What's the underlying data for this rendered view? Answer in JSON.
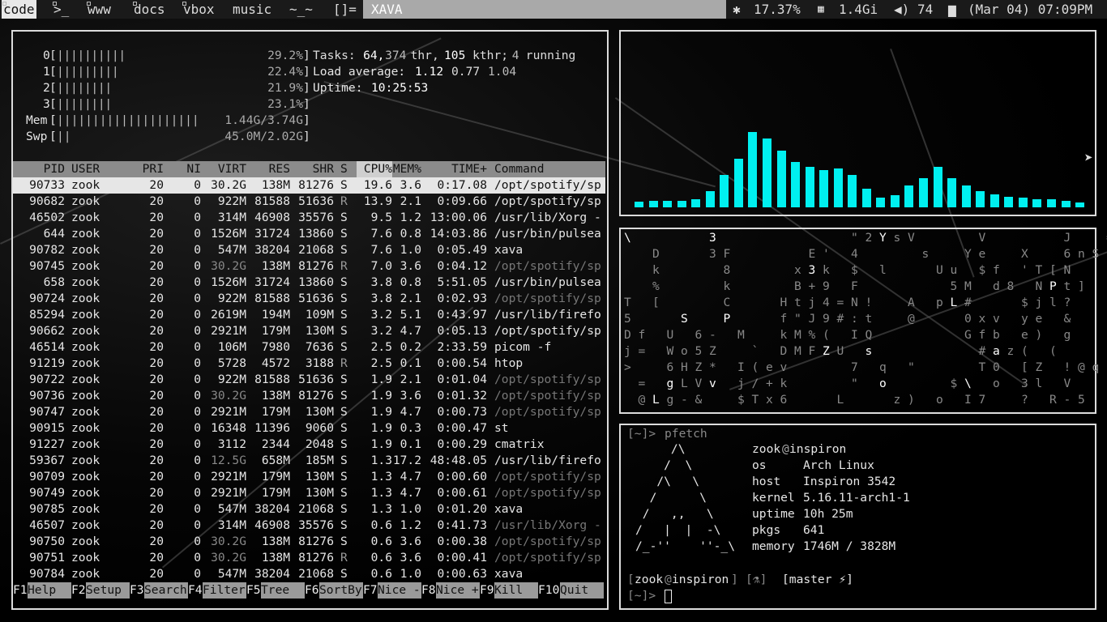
{
  "topbar": {
    "workspaces": [
      "code",
      ">_",
      "www",
      "docs",
      "vbox",
      "music",
      "~_~",
      "[]="
    ],
    "window_title": "XAVA",
    "cpu": "17.37%",
    "memory": "1.4Gi",
    "volume": "74",
    "datetime": "(Mar 04) 07:09PM",
    "icons": [
      "cpu-chip-icon",
      "memory-icon",
      "volume-icon",
      "calendar-icon"
    ]
  },
  "htop": {
    "cpus": [
      {
        "id": "0",
        "bars": "||||||||||",
        "pct": "29.2%"
      },
      {
        "id": "1",
        "bars": "|||||||||",
        "pct": "22.4%"
      },
      {
        "id": "2",
        "bars": "||||||||",
        "pct": "21.9%"
      },
      {
        "id": "3",
        "bars": "||||||||",
        "pct": "23.1%"
      }
    ],
    "mem": {
      "label": "Mem",
      "bars": "||||||||||||||||||||",
      "value": "1.44G/3.74G"
    },
    "swp": {
      "label": "Swp",
      "bars": "||",
      "value": "45.0M/2.02G"
    },
    "tasks_label": "Tasks:",
    "tasks": "64,",
    "thr": "374",
    "thr_label": "thr,",
    "kthr": "105",
    "kthr_label": "kthr;",
    "running": "4",
    "running_label": "running",
    "load_label": "Load average:",
    "load1": "1.12",
    "load5": "0.77",
    "load15": "1.04",
    "uptime_label": "Uptime:",
    "uptime": "10:25:53",
    "columns": [
      "PID",
      "USER",
      "PRI",
      "NI",
      "VIRT",
      "RES",
      "SHR",
      "S",
      "CPU%",
      "MEM%",
      "TIME+",
      "Command"
    ],
    "processes": [
      [
        "90733",
        "zook",
        "20",
        "0",
        "30.2G",
        "138M",
        "81276",
        "S",
        "19.6",
        "3.6",
        "0:17.08",
        "/opt/spotify/sp"
      ],
      [
        "90682",
        "zook",
        "20",
        "0",
        "922M",
        "81588",
        "51636",
        "R",
        "13.9",
        "2.1",
        "0:09.66",
        "/opt/spotify/sp"
      ],
      [
        "46502",
        "zook",
        "20",
        "0",
        "314M",
        "46908",
        "35576",
        "S",
        "9.5",
        "1.2",
        "13:00.06",
        "/usr/lib/Xorg -"
      ],
      [
        "644",
        "zook",
        "20",
        "0",
        "1526M",
        "31724",
        "13860",
        "S",
        "7.6",
        "0.8",
        "14:03.86",
        "/usr/bin/pulsea"
      ],
      [
        "90782",
        "zook",
        "20",
        "0",
        "547M",
        "38204",
        "21068",
        "S",
        "7.6",
        "1.0",
        "0:05.49",
        "xava"
      ],
      [
        "90745",
        "zook",
        "20",
        "0",
        "30.2G",
        "138M",
        "81276",
        "R",
        "7.0",
        "3.6",
        "0:04.12",
        "/opt/spotify/sp"
      ],
      [
        "658",
        "zook",
        "20",
        "0",
        "1526M",
        "31724",
        "13860",
        "S",
        "3.8",
        "0.8",
        "5:51.05",
        "/usr/bin/pulsea"
      ],
      [
        "90724",
        "zook",
        "20",
        "0",
        "922M",
        "81588",
        "51636",
        "S",
        "3.8",
        "2.1",
        "0:02.93",
        "/opt/spotify/sp"
      ],
      [
        "85294",
        "zook",
        "20",
        "0",
        "2619M",
        "194M",
        "109M",
        "S",
        "3.2",
        "5.1",
        "0:43.97",
        "/usr/lib/firefo"
      ],
      [
        "90662",
        "zook",
        "20",
        "0",
        "2921M",
        "179M",
        "130M",
        "S",
        "3.2",
        "4.7",
        "0:05.13",
        "/opt/spotify/sp"
      ],
      [
        "46514",
        "zook",
        "20",
        "0",
        "106M",
        "7980",
        "7636",
        "S",
        "2.5",
        "0.2",
        "2:33.59",
        "picom -f"
      ],
      [
        "91219",
        "zook",
        "20",
        "0",
        "5728",
        "4572",
        "3188",
        "R",
        "2.5",
        "0.1",
        "0:00.54",
        "htop"
      ],
      [
        "90722",
        "zook",
        "20",
        "0",
        "922M",
        "81588",
        "51636",
        "S",
        "1.9",
        "2.1",
        "0:01.04",
        "/opt/spotify/sp"
      ],
      [
        "90736",
        "zook",
        "20",
        "0",
        "30.2G",
        "138M",
        "81276",
        "S",
        "1.9",
        "3.6",
        "0:01.32",
        "/opt/spotify/sp"
      ],
      [
        "90747",
        "zook",
        "20",
        "0",
        "2921M",
        "179M",
        "130M",
        "S",
        "1.9",
        "4.7",
        "0:00.73",
        "/opt/spotify/sp"
      ],
      [
        "90915",
        "zook",
        "20",
        "0",
        "16348",
        "11396",
        "9060",
        "S",
        "1.9",
        "0.3",
        "0:00.47",
        "st"
      ],
      [
        "91227",
        "zook",
        "20",
        "0",
        "3112",
        "2344",
        "2048",
        "S",
        "1.9",
        "0.1",
        "0:00.29",
        "cmatrix"
      ],
      [
        "59367",
        "zook",
        "20",
        "0",
        "12.5G",
        "658M",
        "185M",
        "S",
        "1.3",
        "17.2",
        "48:48.05",
        "/usr/lib/firefo"
      ],
      [
        "90709",
        "zook",
        "20",
        "0",
        "2921M",
        "179M",
        "130M",
        "S",
        "1.3",
        "4.7",
        "0:00.60",
        "/opt/spotify/sp"
      ],
      [
        "90749",
        "zook",
        "20",
        "0",
        "2921M",
        "179M",
        "130M",
        "S",
        "1.3",
        "4.7",
        "0:00.61",
        "/opt/spotify/sp"
      ],
      [
        "90785",
        "zook",
        "20",
        "0",
        "547M",
        "38204",
        "21068",
        "S",
        "1.3",
        "1.0",
        "0:01.20",
        "xava"
      ],
      [
        "46507",
        "zook",
        "20",
        "0",
        "314M",
        "46908",
        "35576",
        "S",
        "0.6",
        "1.2",
        "0:41.73",
        "/usr/lib/Xorg -"
      ],
      [
        "90750",
        "zook",
        "20",
        "0",
        "30.2G",
        "138M",
        "81276",
        "S",
        "0.6",
        "3.6",
        "0:00.38",
        "/opt/spotify/sp"
      ],
      [
        "90751",
        "zook",
        "20",
        "0",
        "30.2G",
        "138M",
        "81276",
        "R",
        "0.6",
        "3.6",
        "0:00.41",
        "/opt/spotify/sp"
      ],
      [
        "90784",
        "zook",
        "20",
        "0",
        "547M",
        "38204",
        "21068",
        "S",
        "0.6",
        "1.0",
        "0:00.63",
        "xava"
      ]
    ],
    "thread_rows": [
      5,
      7,
      12,
      13,
      14,
      18,
      19,
      21,
      22,
      23
    ],
    "fkeys": [
      {
        "key": "F1",
        "label": "Help  "
      },
      {
        "key": "F2",
        "label": "Setup "
      },
      {
        "key": "F3",
        "label": "Search"
      },
      {
        "key": "F4",
        "label": "Filter"
      },
      {
        "key": "F5",
        "label": "Tree  "
      },
      {
        "key": "F6",
        "label": "SortBy"
      },
      {
        "key": "F7",
        "label": "Nice -"
      },
      {
        "key": "F8",
        "label": "Nice +"
      },
      {
        "key": "F9",
        "label": "Kill  "
      },
      {
        "key": "F10",
        "label": "Quit  "
      }
    ]
  },
  "xava": {
    "color": "#00f0f0",
    "levels": [
      0.07,
      0.08,
      0.08,
      0.08,
      0.1,
      0.2,
      0.4,
      0.6,
      0.93,
      0.85,
      0.7,
      0.56,
      0.5,
      0.46,
      0.48,
      0.4,
      0.23,
      0.12,
      0.15,
      0.27,
      0.36,
      0.5,
      0.36,
      0.27,
      0.2,
      0.16,
      0.13,
      0.12,
      0.1,
      0.1,
      0.08,
      0.06
    ]
  },
  "cmatrix": {
    "chars": [
      [
        "\\",
        "",
        "",
        "",
        "",
        "",
        "3",
        "",
        "",
        "",
        "",
        "",
        "",
        "",
        "",
        "",
        "\"",
        "2",
        "Y",
        "s",
        "V",
        "",
        "",
        "",
        "",
        "V",
        "",
        "",
        "",
        "",
        "",
        "J",
        "",
        "",
        "=",
        "*",
        "]"
      ],
      [
        "",
        "",
        "D",
        "",
        "",
        "",
        "3",
        "F",
        "",
        "",
        "",
        "",
        "",
        "E",
        "'",
        "",
        "4",
        "",
        "",
        "",
        "",
        "s",
        "",
        "",
        "Y",
        "e",
        "",
        "",
        "X",
        "",
        "",
        "6",
        "n",
        "S"
      ],
      [
        "",
        "",
        "k",
        "",
        "",
        "",
        "",
        "8",
        "",
        "",
        "",
        "",
        "x",
        "3",
        "k",
        "",
        "$",
        "",
        "l",
        "",
        "",
        "",
        "U",
        "u",
        "",
        "$",
        "f",
        "",
        "'",
        "T",
        "[",
        "N"
      ],
      [
        "",
        "",
        "%",
        "",
        "",
        "",
        "",
        "k",
        "",
        "",
        "",
        "",
        "B",
        "+",
        "9",
        "",
        "F",
        "",
        "",
        "",
        "",
        "",
        "",
        "5",
        "M",
        "",
        "d",
        "8",
        "",
        "N",
        "P",
        "t",
        "]"
      ],
      [
        "T",
        "",
        "[",
        "",
        "",
        "",
        "",
        "C",
        "",
        "",
        "",
        "H",
        "t",
        "j",
        "4",
        "=",
        "N",
        "!",
        "",
        "",
        "A",
        "",
        "p",
        "L",
        "#",
        "",
        "",
        "",
        "$",
        "j",
        "l",
        "?"
      ],
      [
        "5",
        "",
        "",
        "",
        "S",
        "",
        "",
        "P",
        "",
        "",
        "",
        "f",
        "\"",
        "J",
        "9",
        "#",
        ":",
        "t",
        "",
        "",
        "@",
        "",
        "",
        "",
        "0",
        "x",
        "v",
        "",
        "y",
        "e",
        "",
        "&"
      ],
      [
        "D",
        "f",
        "",
        "U",
        "",
        "6",
        "-",
        "",
        "M",
        "",
        "",
        "k",
        "M",
        "%",
        "(",
        "",
        "I",
        "Q",
        "",
        "",
        "",
        "",
        "",
        "",
        "G",
        "f",
        "b",
        "",
        "e",
        ")",
        "",
        "g"
      ],
      [
        "j",
        "=",
        "",
        "W",
        "o",
        "5",
        "Z",
        "",
        "",
        "`",
        "",
        "D",
        "M",
        "F",
        "Z",
        "U",
        "",
        "s",
        "",
        "",
        "",
        "",
        "",
        "",
        "",
        "#",
        "a",
        "z",
        "(",
        "",
        "("
      ],
      [
        ">",
        "",
        "",
        "6",
        "H",
        "Z",
        "*",
        "",
        "I",
        "(",
        "e",
        "v",
        "",
        "",
        "",
        "",
        "7",
        "",
        "q",
        "",
        "\"",
        "",
        "",
        "",
        "",
        "T",
        "0",
        "",
        "[",
        "Z",
        "",
        "!",
        "@",
        "q"
      ],
      [
        "",
        "=",
        "",
        "g",
        "L",
        "V",
        "v",
        "",
        "j",
        "/",
        "+",
        "k",
        "",
        "",
        "",
        "",
        "\"",
        "",
        "o",
        "",
        "",
        "",
        "",
        "$",
        "\\",
        "",
        "o",
        "",
        "3",
        "l",
        "",
        "V"
      ],
      [
        "",
        "@",
        "L",
        "g",
        "-",
        "&",
        "",
        "",
        "$",
        "T",
        "x",
        "6",
        "",
        "",
        "",
        "L",
        "",
        "",
        "",
        "z",
        ")",
        "",
        "o",
        "",
        "I",
        "7",
        "",
        "",
        "?",
        "",
        "R",
        "-",
        "5"
      ]
    ]
  },
  "pfetch": {
    "prompt_open": "[~]>",
    "command": "pfetch",
    "logo": [
      "     /\\     ",
      "    /  \\    ",
      "   /\\   \\   ",
      "  /      \\  ",
      " /   ,,   \\ ",
      "/   |  |  -\\",
      "/_-''    ''-_\\"
    ],
    "user": "zook",
    "at": "@",
    "hostname": "inspiron",
    "info": [
      {
        "key": "os",
        "value": "Arch Linux"
      },
      {
        "key": "host",
        "value": "Inspiron 3542"
      },
      {
        "key": "kernel",
        "value": "5.16.11-arch1-1"
      },
      {
        "key": "uptime",
        "value": "10h 25m"
      },
      {
        "key": "pkgs",
        "value": "641"
      },
      {
        "key": "memory",
        "value": "1746M / 3828M"
      }
    ],
    "shell_user": "zook",
    "shell_host": "inspiron",
    "flask": "[⚗]",
    "branch": "[master ⚡]",
    "prompt2": "[~]>"
  }
}
